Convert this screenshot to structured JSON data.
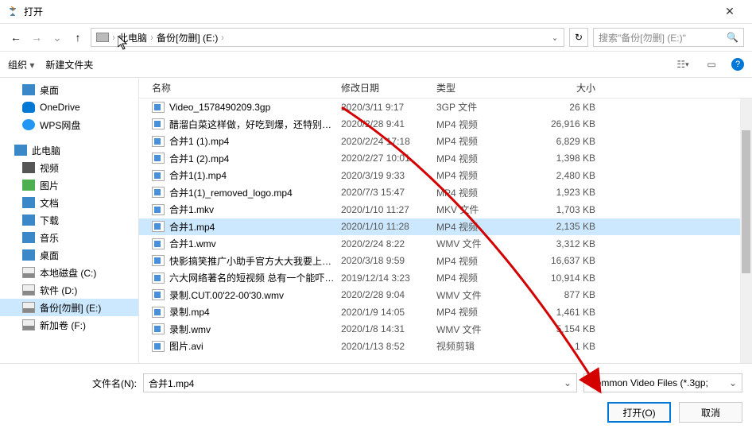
{
  "title": "打开",
  "breadcrumb": {
    "root": "此电脑",
    "current": "备份[勿删] (E:)"
  },
  "search_placeholder": "搜索\"备份[勿删] (E:)\"",
  "toolbar": {
    "organize": "组织",
    "newfolder": "新建文件夹"
  },
  "sidebar": [
    {
      "label": "桌面",
      "icon": "ic-desktop"
    },
    {
      "label": "OneDrive",
      "icon": "ic-onedrive"
    },
    {
      "label": "WPS网盘",
      "icon": "ic-wps"
    },
    {
      "label": "此电脑",
      "icon": "ic-pc",
      "group": true
    },
    {
      "label": "视频",
      "icon": "ic-video"
    },
    {
      "label": "图片",
      "icon": "ic-pic"
    },
    {
      "label": "文档",
      "icon": "ic-doc"
    },
    {
      "label": "下载",
      "icon": "ic-dl"
    },
    {
      "label": "音乐",
      "icon": "ic-music"
    },
    {
      "label": "桌面",
      "icon": "ic-desktop"
    },
    {
      "label": "本地磁盘 (C:)",
      "icon": "ic-drive"
    },
    {
      "label": "软件 (D:)",
      "icon": "ic-drive"
    },
    {
      "label": "备份[勿删] (E:)",
      "icon": "ic-drive",
      "selected": true
    },
    {
      "label": "新加卷 (F:)",
      "icon": "ic-drive"
    }
  ],
  "columns": {
    "name": "名称",
    "date": "修改日期",
    "type": "类型",
    "size": "大小"
  },
  "files": [
    {
      "name": "Video_1578490209.3gp",
      "date": "2020/3/11 9:17",
      "type": "3GP 文件",
      "size": "26 KB"
    },
    {
      "name": "醋溜白菜这样做，好吃到爆，还特别下饭...",
      "date": "2020/2/28 9:41",
      "type": "MP4 视频",
      "size": "26,916 KB"
    },
    {
      "name": "合并1 (1).mp4",
      "date": "2020/2/24 17:18",
      "type": "MP4 视频",
      "size": "6,829 KB"
    },
    {
      "name": "合并1 (2).mp4",
      "date": "2020/2/27 10:01",
      "type": "MP4 视频",
      "size": "1,398 KB"
    },
    {
      "name": "合并1(1).mp4",
      "date": "2020/3/19 9:33",
      "type": "MP4 视频",
      "size": "2,480 KB"
    },
    {
      "name": "合并1(1)_removed_logo.mp4",
      "date": "2020/7/3 15:47",
      "type": "MP4 视频",
      "size": "1,923 KB"
    },
    {
      "name": "合并1.mkv",
      "date": "2020/1/10 11:27",
      "type": "MKV 文件",
      "size": "1,703 KB"
    },
    {
      "name": "合并1.mp4",
      "date": "2020/1/10 11:28",
      "type": "MP4 视频",
      "size": "2,135 KB",
      "selected": true
    },
    {
      "name": "合并1.wmv",
      "date": "2020/2/24 8:22",
      "type": "WMV 文件",
      "size": "3,312 KB"
    },
    {
      "name": "快影搞笑推广小助手官方大大我要上热门...",
      "date": "2020/3/18 9:59",
      "type": "MP4 视频",
      "size": "16,637 KB"
    },
    {
      "name": "六大网络著名的短视频 总有一个能吓着...",
      "date": "2019/12/14 3:23",
      "type": "MP4 视频",
      "size": "10,914 KB"
    },
    {
      "name": "录制.CUT.00'22-00'30.wmv",
      "date": "2020/2/28 9:04",
      "type": "WMV 文件",
      "size": "877 KB"
    },
    {
      "name": "录制.mp4",
      "date": "2020/1/9 14:05",
      "type": "MP4 视频",
      "size": "1,461 KB"
    },
    {
      "name": "录制.wmv",
      "date": "2020/1/8 14:31",
      "type": "WMV 文件",
      "size": "5,154 KB"
    },
    {
      "name": "图片.avi",
      "date": "2020/1/13 8:52",
      "type": "视频剪辑",
      "size": "1 KB"
    }
  ],
  "filename_label": "文件名(N):",
  "filename_value": "合并1.mp4",
  "filter_value": "Common Video Files (*.3gp;",
  "buttons": {
    "open": "打开(O)",
    "cancel": "取消"
  }
}
